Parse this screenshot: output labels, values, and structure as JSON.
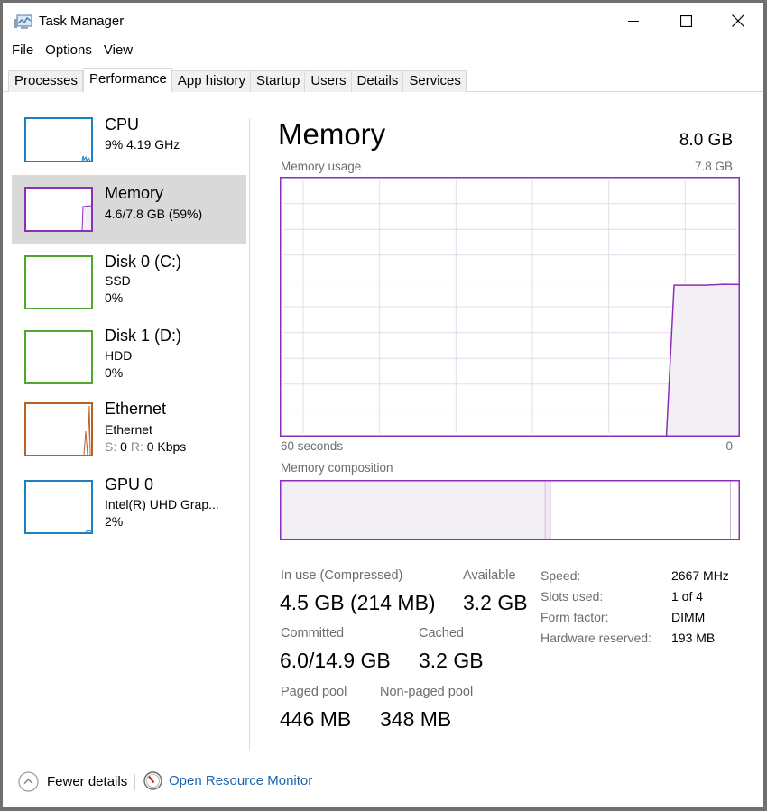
{
  "window": {
    "title": "Task Manager",
    "controls": {
      "minimize": "minimize",
      "maximize": "maximize",
      "close": "close"
    }
  },
  "menu": [
    "File",
    "Options",
    "View"
  ],
  "tabs": [
    {
      "label": "Processes",
      "active": false
    },
    {
      "label": "Performance",
      "active": true
    },
    {
      "label": "App history",
      "active": false
    },
    {
      "label": "Startup",
      "active": false
    },
    {
      "label": "Users",
      "active": false
    },
    {
      "label": "Details",
      "active": false
    },
    {
      "label": "Services",
      "active": false
    }
  ],
  "sidebar": {
    "items": [
      {
        "title": "CPU",
        "line1": "9% 4.19 GHz",
        "line2": "",
        "color": "#1c7fc1",
        "selected": false
      },
      {
        "title": "Memory",
        "line1": "4.6/7.8 GB (59%)",
        "line2": "",
        "color": "#8b2fb8",
        "selected": true
      },
      {
        "title": "Disk 0 (C:)",
        "line1": "SSD",
        "line2": "0%",
        "color": "#4ea72e",
        "selected": false
      },
      {
        "title": "Disk 1 (D:)",
        "line1": "HDD",
        "line2": "0%",
        "color": "#4ea72e",
        "selected": false
      },
      {
        "title": "Ethernet",
        "line1": "Ethernet",
        "line2_prefix_s": "S:",
        "line2_s": "0",
        "line2_prefix_r": "R:",
        "line2_r": "0 Kbps",
        "color": "#b86125",
        "selected": false
      },
      {
        "title": "GPU 0",
        "line1": "Intel(R) UHD Grap...",
        "line2": "2%",
        "color": "#1c7fc1",
        "selected": false
      }
    ]
  },
  "main": {
    "title": "Memory",
    "total": "8.0 GB",
    "usage_label": "Memory usage",
    "usage_max": "7.8 GB",
    "x_left": "60 seconds",
    "x_right": "0",
    "composition_label": "Memory composition",
    "stats": {
      "in_use_label": "In use (Compressed)",
      "in_use_value": "4.5 GB (214 MB)",
      "available_label": "Available",
      "available_value": "3.2 GB",
      "committed_label": "Committed",
      "committed_value": "6.0/14.9 GB",
      "cached_label": "Cached",
      "cached_value": "3.2 GB",
      "paged_label": "Paged pool",
      "paged_value": "446 MB",
      "nonpaged_label": "Non-paged pool",
      "nonpaged_value": "348 MB"
    },
    "details": [
      {
        "label": "Speed:",
        "value": "2667 MHz"
      },
      {
        "label": "Slots used:",
        "value": "1 of 4"
      },
      {
        "label": "Form factor:",
        "value": "DIMM"
      },
      {
        "label": "Hardware reserved:",
        "value": "193 MB"
      }
    ]
  },
  "colors": {
    "memory": "#8b2fb8",
    "memory_fill": "#f2eff5",
    "grid": "#e4dcea"
  },
  "chart_data": {
    "type": "area",
    "title": "Memory usage",
    "xlabel": "60 seconds",
    "ylabel": "",
    "x_range_seconds": [
      60,
      0
    ],
    "ylim_gb": [
      0,
      7.8
    ],
    "y_max_label": "7.8 GB",
    "grid": true,
    "series": [
      {
        "name": "In use",
        "x_seconds_ago": [
          60,
          9.5,
          8.5,
          4.5,
          2.5,
          2,
          0
        ],
        "values_gb": [
          0,
          0,
          4.55,
          4.55,
          4.57,
          4.58,
          4.57
        ]
      }
    ],
    "composition": {
      "in_use_gb": 4.5,
      "modified_gb": 0.1,
      "standby_gb": 3.1,
      "free_gb": 0.1,
      "total_gb": 7.8
    }
  },
  "footer": {
    "fewer_details": "Fewer details",
    "open_resource_monitor": "Open Resource Monitor"
  }
}
